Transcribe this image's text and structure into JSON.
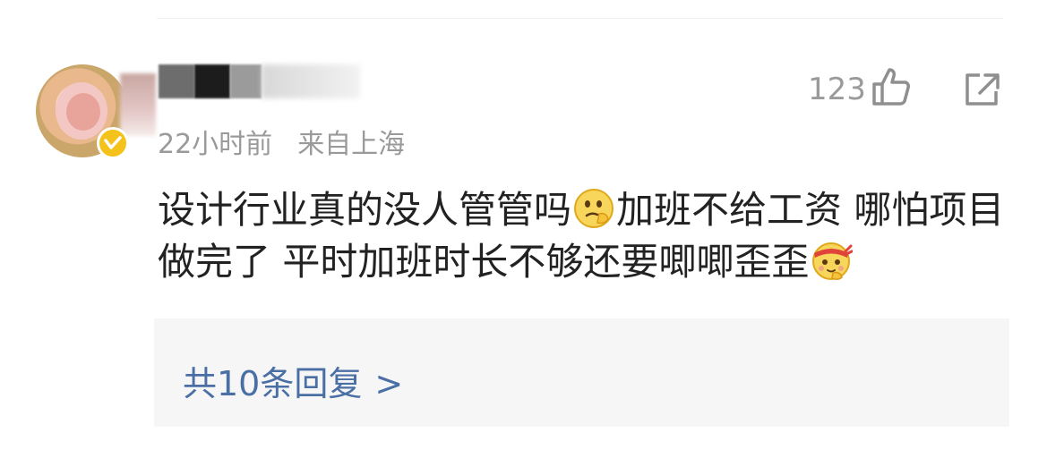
{
  "comment": {
    "time": "22小时前",
    "location": "来自上海",
    "like_count": "123",
    "text_part1": "设计行业真的没人管管吗",
    "text_part2": "加班不给工资  哪怕项目做完了 平时加班时长不够还要唧唧歪歪",
    "emoji_1": "thinking-face-icon",
    "emoji_2": "headband-face-icon"
  },
  "replies": {
    "label": "共10条回复",
    "chevron": ">"
  },
  "colors": {
    "meta": "#9a9a9a",
    "text": "#222222",
    "link": "#4a6fa5",
    "reply_bg": "#f6f6f6",
    "badge": "#f4c21a"
  }
}
